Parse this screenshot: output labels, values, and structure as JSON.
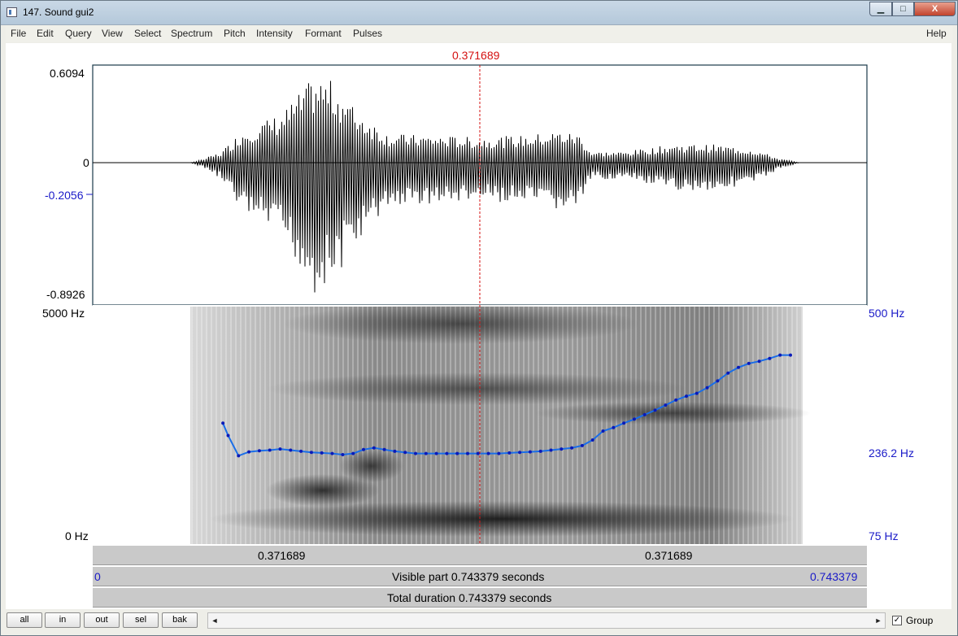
{
  "window": {
    "title": "147. Sound gui2",
    "controls": {
      "minimize": "▁",
      "maximize": "□",
      "close": "X"
    }
  },
  "menu": [
    "File",
    "Edit",
    "Query",
    "View",
    "Select",
    "Spectrum",
    "Pitch",
    "Intensity",
    "Formant",
    "Pulses"
  ],
  "help": "Help",
  "cursor": {
    "time_label": "0.371689",
    "time": 0.371689
  },
  "waveform": {
    "ymax_label": "0.6094",
    "zero_label": "0",
    "cursor_value_label": "-0.2056",
    "ymin_label": "-0.8926",
    "ymax": 0.6094,
    "ymin": -0.8926,
    "cursor_value": -0.2056
  },
  "spectrogram": {
    "fmax_label": "5000 Hz",
    "fmin_label": "0 Hz",
    "fmax_hz": 5000,
    "fmin_hz": 0
  },
  "pitch": {
    "top_label": "500 Hz",
    "cursor_label": "236.2 Hz",
    "bottom_label": "75 Hz",
    "top_hz": 500,
    "cursor_hz": 236.2,
    "bottom_hz": 75,
    "line_color": "#1a6ee8",
    "point_color": "#0a1ab8"
  },
  "chart_data": {
    "type": "line",
    "series": [
      {
        "name": "",
        "x": [
          0.125,
          0.13,
          0.14,
          0.15,
          0.16,
          0.17,
          0.18,
          0.19,
          0.2,
          0.21,
          0.22,
          0.23,
          0.24,
          0.25,
          0.26,
          0.27,
          0.28,
          0.29,
          0.3,
          0.31,
          0.32,
          0.33,
          0.34,
          0.35,
          0.36,
          0.37,
          0.38,
          0.39,
          0.4,
          0.41,
          0.42,
          0.43,
          0.44,
          0.45,
          0.46,
          0.47,
          0.48,
          0.49,
          0.5,
          0.51,
          0.52,
          0.53,
          0.54,
          0.55,
          0.56,
          0.57,
          0.58,
          0.59,
          0.6,
          0.61,
          0.62,
          0.63,
          0.64,
          0.65,
          0.66,
          0.67
        ],
        "y": [
          290,
          268,
          232,
          239,
          241,
          242,
          244,
          242,
          240,
          238,
          237,
          236,
          234,
          236,
          243,
          246,
          243,
          240,
          238,
          236,
          236,
          236,
          236,
          236,
          236,
          236,
          236,
          236,
          237,
          238,
          239,
          240,
          242,
          244,
          246,
          250,
          260,
          276,
          282,
          290,
          297,
          305,
          313,
          322,
          331,
          338,
          343,
          353,
          365,
          379,
          389,
          396,
          400,
          405,
          411,
          411
        ]
      }
    ],
    "xlim": [
      0,
      0.743379
    ],
    "ylim": [
      75,
      500
    ]
  },
  "timebar": {
    "left_label": "0.371689",
    "right_label": "0.371689"
  },
  "visible": {
    "start_label": "0",
    "text": "Visible part 0.743379 seconds",
    "end_label": "0.743379"
  },
  "total": {
    "text": "Total duration 0.743379 seconds"
  },
  "buttons": {
    "all": "all",
    "in": "in",
    "out": "out",
    "sel": "sel",
    "bak": "bak"
  },
  "scroll": {
    "left": "◄",
    "right": "►"
  },
  "group": {
    "label": "Group",
    "checked": "✓"
  }
}
